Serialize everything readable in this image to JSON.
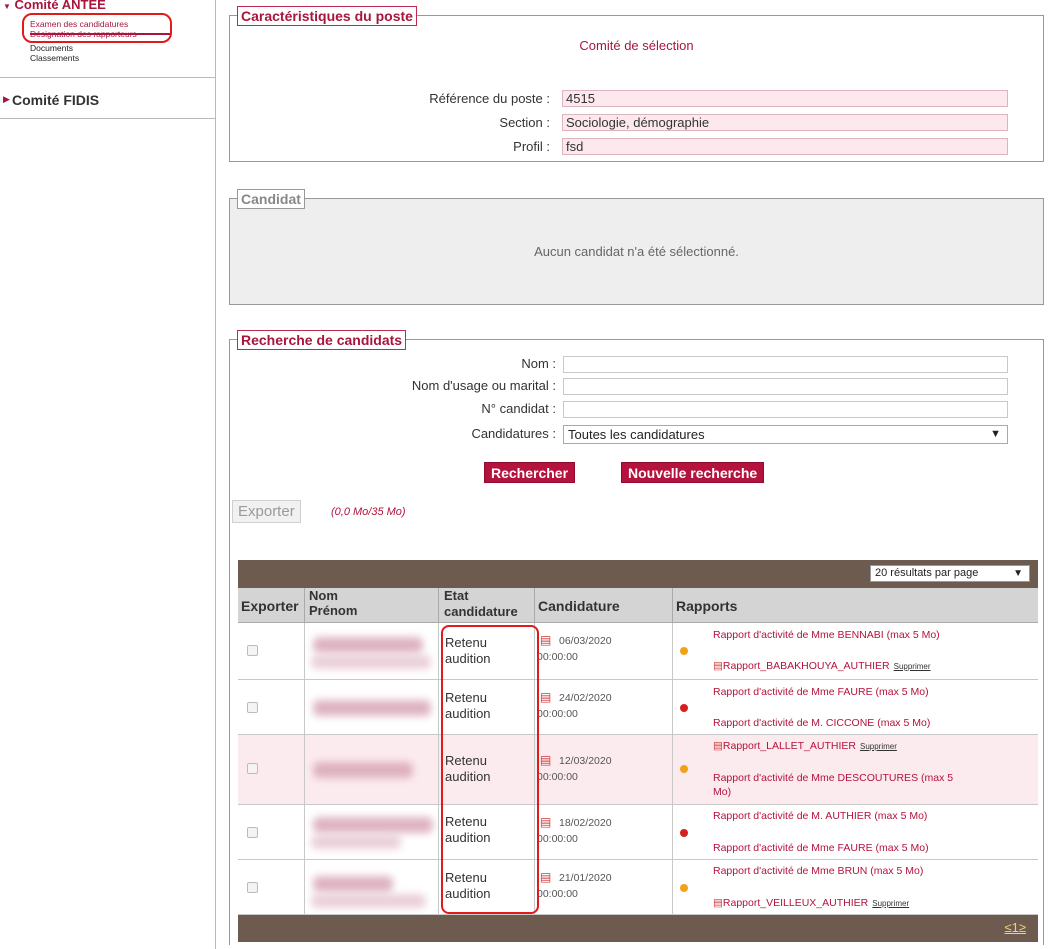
{
  "sidebar": {
    "header": "Comité ANTEE",
    "sub_items": [
      "Examen des candidatures",
      "Désignation des rapporteurs",
      "Documents",
      "Classements"
    ],
    "fidis": "Comité FIDIS"
  },
  "poste": {
    "legend": "Caractéristiques du poste",
    "comite": "Comité de sélection",
    "fields": [
      {
        "label": "Référence du poste :",
        "value": "4515"
      },
      {
        "label": "Section :",
        "value": "Sociologie, démographie"
      },
      {
        "label": "Profil :",
        "value": "fsd"
      }
    ]
  },
  "candidat": {
    "legend": "Candidat",
    "empty": "Aucun candidat n'a été sélectionné."
  },
  "search": {
    "legend": "Recherche de candidats",
    "labels": [
      "Nom :",
      "Nom d'usage ou marital :",
      "N° candidat :",
      "Candidatures :"
    ],
    "candidatures_value": "Toutes les candidatures",
    "btn_search": "Rechercher",
    "btn_new": "Nouvelle recherche",
    "btn_export": "Exporter",
    "export_size": "(0,0 Mo/35 Mo)"
  },
  "results": {
    "per_page": "20 résultats par page",
    "headers": {
      "exporter": "Exporter",
      "nom": "Nom",
      "prenom": "Prénom",
      "etat1": "Etat",
      "etat2": "candidature",
      "candidature": "Candidature",
      "rapports": "Rapports"
    },
    "rows": [
      {
        "etat1": "Retenu",
        "etat2": "audition",
        "date": "06/03/2020",
        "time": "00:00:00",
        "dot": "orange",
        "r1": "Rapport d'activité de Mme BENNABI (max 5 Mo)",
        "r2": "Rapport_BABAKHOUYA_AUTHIER",
        "r2del": "Supprimer"
      },
      {
        "etat1": "Retenu",
        "etat2": "audition",
        "date": "24/02/2020",
        "time": "00:00:00",
        "dot": "red",
        "r1": "Rapport d'activité de Mme FAURE (max 5 Mo)",
        "r2": "Rapport d'activité de M. CICCONE (max 5 Mo)"
      },
      {
        "etat1": "Retenu",
        "etat2": "audition",
        "date": "12/03/2020",
        "time": "00:00:00",
        "dot": "orange",
        "r1": "Rapport_LALLET_AUTHIER",
        "r1del": "Supprimer",
        "r2a": "Rapport d'activité de Mme DESCOUTURES (max 5",
        "r2b": "Mo)"
      },
      {
        "etat1": "Retenu",
        "etat2": "audition",
        "date": "18/02/2020",
        "time": "00:00:00",
        "dot": "red",
        "r1": "Rapport d'activité de M. AUTHIER (max 5 Mo)",
        "r2": "Rapport d'activité de Mme FAURE (max 5 Mo)"
      },
      {
        "etat1": "Retenu",
        "etat2": "audition",
        "date": "21/01/2020",
        "time": "00:00:00",
        "dot": "orange",
        "r1": "Rapport d'activité de Mme BRUN (max 5 Mo)",
        "r2": "Rapport_VEILLEUX_AUTHIER",
        "r2del": "Supprimer"
      }
    ],
    "pager": "≤1≥"
  }
}
